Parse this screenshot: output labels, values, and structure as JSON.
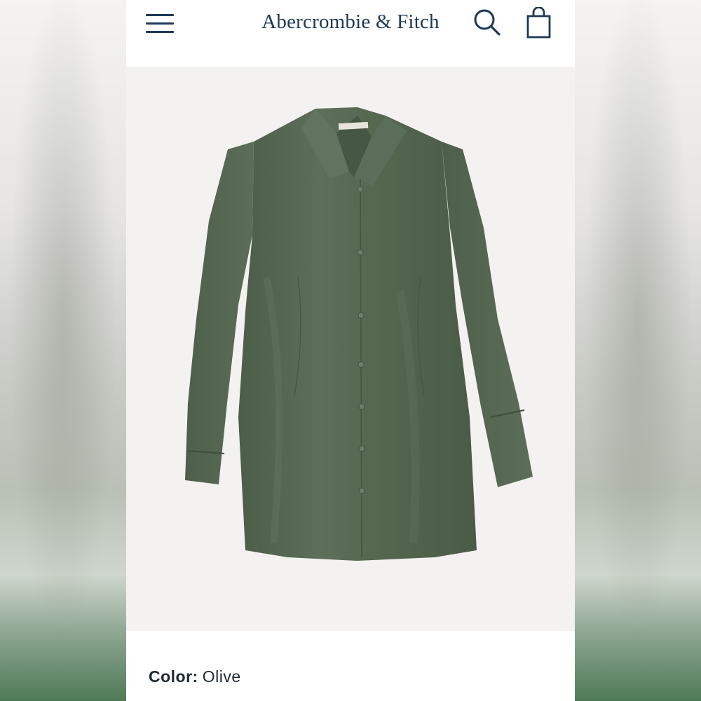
{
  "header": {
    "brand": "Abercrombie & Fitch",
    "menu_icon": "hamburger-menu-icon",
    "search_icon": "search-icon",
    "bag_icon": "shopping-bag-icon",
    "brand_color": "#1d3a57"
  },
  "product": {
    "image_alt": "Olive satin long-sleeve button-front shirt dress",
    "garment_color": "#556653",
    "color_label": "Color:",
    "color_value": "Olive"
  }
}
